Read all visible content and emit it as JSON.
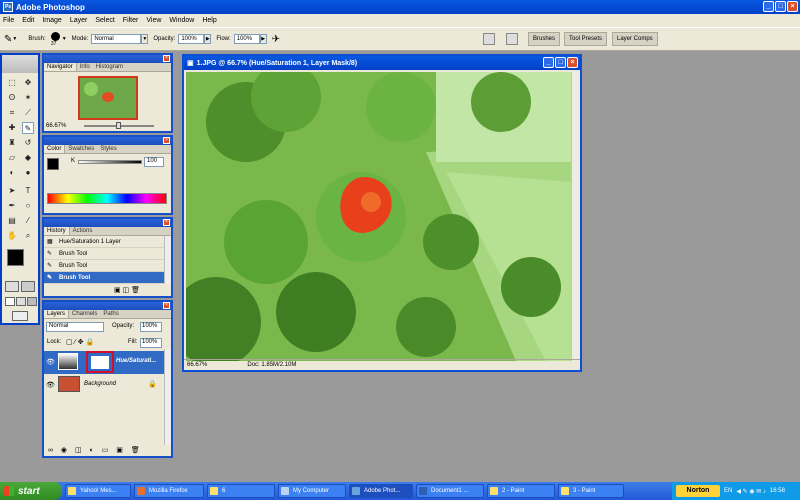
{
  "app": {
    "title": "Adobe Photoshop"
  },
  "menu": [
    "File",
    "Edit",
    "Image",
    "Layer",
    "Select",
    "Filter",
    "View",
    "Window",
    "Help"
  ],
  "options": {
    "brush_label": "Brush:",
    "brush_size": "37",
    "mode_label": "Mode:",
    "mode_value": "Normal",
    "opacity_label": "Opacity:",
    "opacity_value": "100%",
    "flow_label": "Flow:",
    "flow_value": "100%",
    "well_tabs": [
      "Brushes",
      "Tool Presets",
      "Layer Comps"
    ]
  },
  "navigator": {
    "tabs": [
      "Navigator",
      "Info",
      "Histogram"
    ],
    "zoom": "66.67%"
  },
  "color": {
    "tabs": [
      "Color",
      "Swatches",
      "Styles"
    ],
    "channel": "K",
    "value": "100"
  },
  "history": {
    "tabs": [
      "History",
      "Actions"
    ],
    "items": [
      "Hue/Saturation 1 Layer",
      "Brush Tool",
      "Brush Tool",
      "Brush Tool"
    ]
  },
  "layers": {
    "tabs": [
      "Layers",
      "Channels",
      "Paths"
    ],
    "blend_mode": "Normal",
    "opacity_label": "Opacity:",
    "opacity_value": "100%",
    "lock_label": "Lock:",
    "fill_label": "Fill:",
    "fill_value": "100%",
    "items": [
      "Hue/Saturati...",
      "Background"
    ]
  },
  "document": {
    "title": "1.JPG @ 66.7% (Hue/Saturation 1, Layer Mask/8)",
    "zoom": "66.67%",
    "doc_size": "Doc: 1.85M/2.10M"
  },
  "taskbar": {
    "start": "start",
    "tasks": [
      "Yahoo! Mes...",
      "Mozilla Firefox",
      "6",
      "My Computer",
      "Adobe Phot...",
      "Document1 ...",
      "2 - Paint",
      "3 - Paint"
    ],
    "norton": "Norton",
    "lang": "EN",
    "clock": "16:58"
  },
  "colors": {
    "xp_blue": "#0040c8",
    "palette_bg": "#ece9d8",
    "workspace": "#9a9a9a",
    "photo_green": "#7fbf55",
    "flower_red": "#e8401a"
  }
}
